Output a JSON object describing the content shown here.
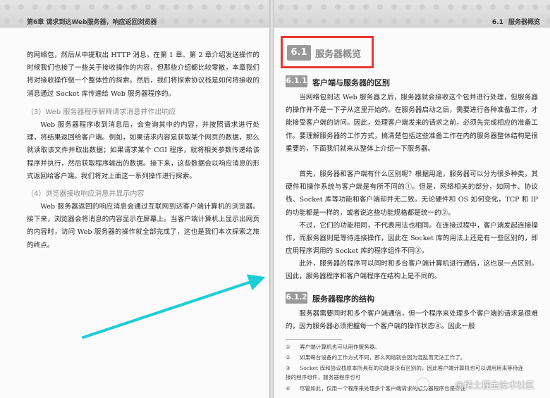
{
  "left_page": {
    "header": "第6章  请求到达Web服务器，响应返回浏览器",
    "para1": "的网络包，然后从中提取出 HTTP 消息。在第 1 章、第 2 章介绍发送操作的时候我们也接了一些关于接收操作的内容，但那些介绍都比较零散，本章我们将对接收操作做一个整体性的探索。然后，我们将探索协议栈是如何将接收的消息通过 Socket 库传递给 Web 服务器程序的。",
    "sub3": "（3）Web 服务器程序解释请求消息并作出响应",
    "para2": "Web 服务器程序收到消息后，会查询其中的内容，并按照请求进行处理，将结果返回给客户端。例如，如果请求内容是获取某个网页的数据，那么就读取该文件并取出数据；如果请求某个 CGI 程序，就将相关参数传递给该程序并执行，然后获取程序输出的数据。接下来，这些数据会以响应消息的形式返回给客户端。我们将对上面这一系列操作进行探索。",
    "sub4": "（4）浏览器接收响应消息并显示内容",
    "para3": "Web 服务器返回的响应消息会通过互联网到达客户端计算机的浏览器。接下来，浏览器会将消息的内容显示在屏幕上。当客户端计算机上显示出网页的内容时，访问 Web 服务器的操作就全部完成了，这也是我们本次探索之旅的终点。"
  },
  "right_page": {
    "header_num": "6.1",
    "header_title": "服务器概览",
    "section_num": "6.1",
    "section_title": "服务器概览",
    "h611_num": "6.1.1",
    "h611_title": "客户端与服务器的区别",
    "para1": "当网络包到达 Web 服务器之后，服务器就会接收这个包并进行处理，但服务器的操作并不是一下子从这里开始的。在服务器启动之后，需要进行各种准备工作，才能接受客户端的访问。因此，处理客户端发来的请求之前，必须先完成相应的准备工作。要理解服务器的工作方式，搞清楚包括这些准备工作在内的服务器整体结构是很重要的，下面我们就来从整体上介绍一下服务器。",
    "para2": "首先，服务器和客户端有什么区别呢？根据用途，服务器可以分为很多种类，其硬件和操作系统与客户端是有所不同的①。但是，网络相关的部分，如网卡、协议栈、Socket 库等功能和客户端却并无二致。无论硬件和 OS 如何变化，TCP 和 IP 的功能都是一样的，或者说这些功能规格都是统一的②。",
    "para3": "不过，它们的功能相同，不代表用法也相同。在连接过程中，客户端发起连接操作，而服务器则是等待连接操作，因此在 Socket 库的用法上还是有一些区别的，即应用程序调用的 Socket 库的程序组件不同③。",
    "para4": "此外，服务器的程序可以同时和多台客户端计算机进行通信，这也是一点区别。因此，服务器程序和客户端程序在结构上是不同的。",
    "h612_num": "6.1.2",
    "h612_title": "服务器程序的结构",
    "para5": "服务器需要同时和多个客户端通信，但一个程序来处理多个客户端的请求是很难的，因为服务器必须把握每一个客户端的操作状态④。因此一般",
    "footnotes": [
      {
        "mark": "①",
        "text": "客户端计算机也可以用作服务器。"
      },
      {
        "mark": "②",
        "text": "如果每台设备的工作方式不同，那么网络就会因为混乱而无法工作了。"
      },
      {
        "mark": "③",
        "text": "Socket 库和协议栈原本所具有的功能是没有区别的，因此客户端计算机也可以调用用来等待连接的程序组件，服务器程序也可"
      },
      {
        "mark": "④",
        "text": "尽管如此，仅用一个程序来处理多个客户端请求的服务器程序也是存在"
      }
    ],
    "watermark": "@稀土掘金技术社区"
  },
  "colors": {
    "highlight_box": "#e53935",
    "arrow": "#1ccdd6",
    "badge": "#9a9a9a"
  }
}
